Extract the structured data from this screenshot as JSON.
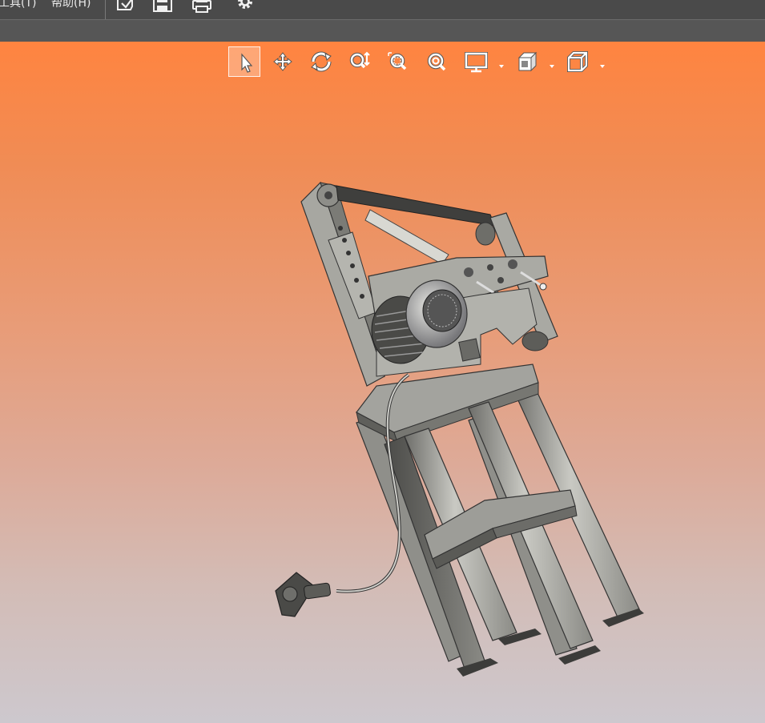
{
  "menubar": {
    "tools_label": "工具(T)",
    "help_label": "帮助(H)"
  },
  "quick_access": {
    "icons": [
      "edit-document-icon",
      "save-icon",
      "print-icon",
      "settings-gear-icon"
    ]
  },
  "view_toolbar": {
    "tools": [
      {
        "name": "select",
        "icon": "cursor-arrow-icon",
        "active": true
      },
      {
        "name": "pan",
        "icon": "move-arrows-icon",
        "active": false
      },
      {
        "name": "rotate",
        "icon": "rotate-icon",
        "active": false
      },
      {
        "name": "zoom",
        "icon": "zoom-in-out-icon",
        "active": false
      },
      {
        "name": "zoom-window",
        "icon": "zoom-window-icon",
        "active": false
      },
      {
        "name": "zoom-fit",
        "icon": "zoom-fit-icon",
        "active": false
      },
      {
        "name": "display-mode",
        "icon": "monitor-icon",
        "has_dropdown": true
      },
      {
        "name": "render-style",
        "icon": "shaded-cube-icon",
        "has_dropdown": true
      },
      {
        "name": "standard-views",
        "icon": "wireframe-cube-icon",
        "has_dropdown": true
      }
    ]
  },
  "colors": {
    "menubar_bg": "#4a4a4a",
    "secondbar_bg": "#565656",
    "viewport_top": "#ff8440",
    "viewport_bottom": "#cdc8ce",
    "model_steel": "#9a9a96",
    "model_dark": "#3c3c3a"
  }
}
